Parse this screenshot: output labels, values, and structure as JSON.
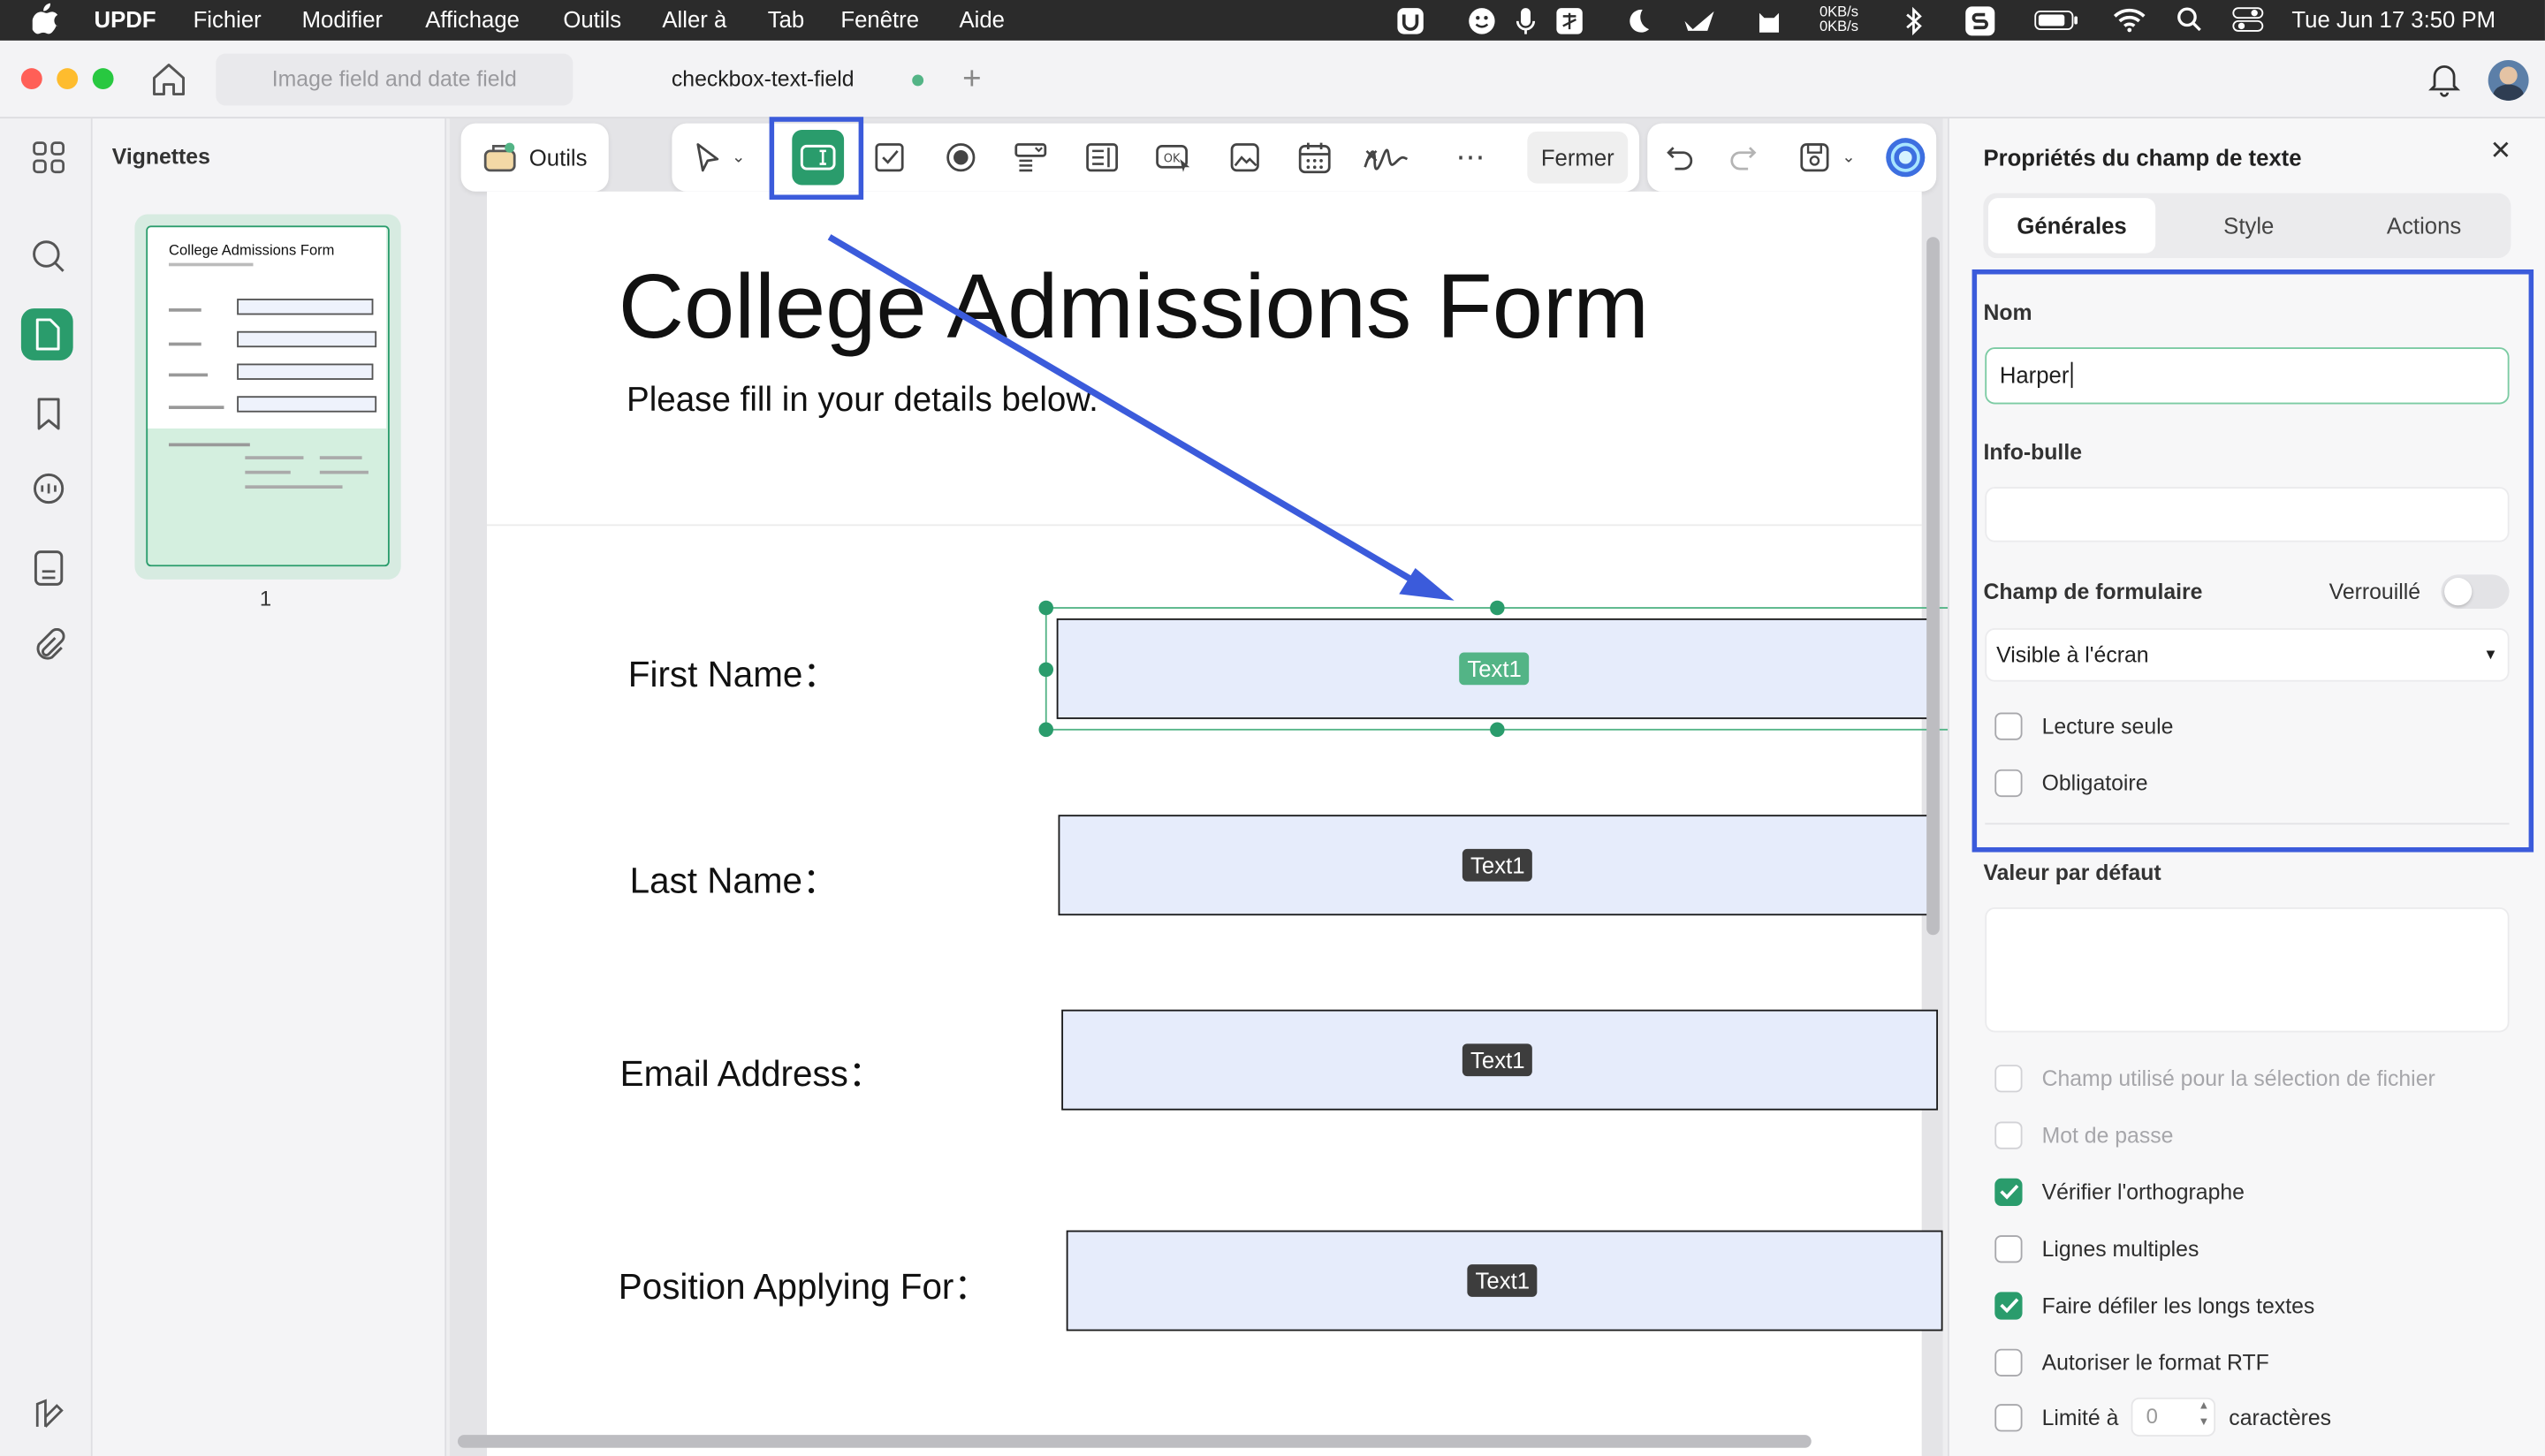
{
  "menubar": {
    "app": "UPDF",
    "items": [
      "Fichier",
      "Modifier",
      "Affichage",
      "Outils",
      "Aller à",
      "Tab",
      "Fenêtre",
      "Aide"
    ],
    "net_up": "0KB/s",
    "net_down": "0KB/s",
    "datetime": "Tue Jun 17  3:50 PM"
  },
  "tabs": [
    {
      "label": "Image field and date field"
    },
    {
      "label": "checkbox-text-field"
    }
  ],
  "thumbs": {
    "title": "Vignettes",
    "page_num": "1",
    "mini_title": "College Admissions Form"
  },
  "toolbar": {
    "tools_label": "Outils",
    "close_label": "Fermer"
  },
  "doc": {
    "title": "College Admissions Form",
    "subtitle": "Please fill in your details below.",
    "fields": [
      {
        "label": "First Name：",
        "tag": "Text1"
      },
      {
        "label": "Last Name：",
        "tag": "Text1"
      },
      {
        "label": "Email Address：",
        "tag": "Text1"
      },
      {
        "label": "Position Applying For：",
        "tag": "Text1"
      }
    ]
  },
  "props": {
    "title": "Propriétés du champ de texte",
    "tabs": [
      "Générales",
      "Style",
      "Actions"
    ],
    "name_label": "Nom",
    "name_value": "Harper",
    "tooltip_label": "Info-bulle",
    "tooltip_value": "",
    "form_field_label": "Champ de formulaire",
    "locked_label": "Verrouillé",
    "visibility": "Visible à l'écran",
    "readonly": "Lecture seule",
    "required": "Obligatoire",
    "default_label": "Valeur par défaut",
    "options": [
      {
        "label": "Champ utilisé pour la sélection de fichier",
        "checked": false,
        "disabled": true
      },
      {
        "label": "Mot de passe",
        "checked": false,
        "disabled": true
      },
      {
        "label": "Vérifier l'orthographe",
        "checked": true,
        "disabled": false
      },
      {
        "label": "Lignes multiples",
        "checked": false,
        "disabled": false
      },
      {
        "label": "Faire défiler les longs textes",
        "checked": true,
        "disabled": false
      },
      {
        "label": "Autoriser le format RTF",
        "checked": false,
        "disabled": false
      }
    ],
    "limit_label": "Limité à",
    "limit_value": "0",
    "limit_suffix": "caractères"
  },
  "colors": {
    "accent": "#2a9c6c",
    "highlight": "#3b5bdb",
    "field_bg": "#e6ecfb"
  }
}
